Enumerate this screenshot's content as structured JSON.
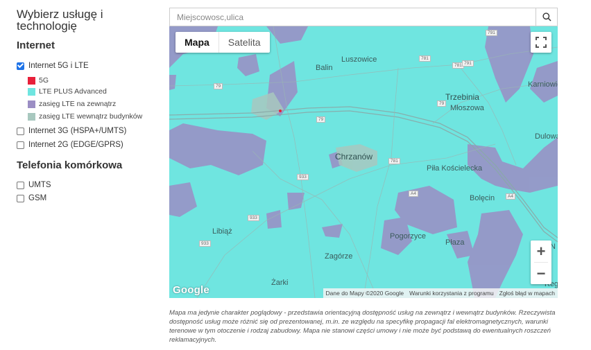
{
  "sidebar": {
    "title": "Wybierz usługę i technologię",
    "internet_heading": "Internet",
    "internet_options": [
      {
        "label": "Internet 5G i LTE",
        "checked": true
      },
      {
        "label": "Internet 3G (HSPA+/UMTS)",
        "checked": false
      },
      {
        "label": "Internet 2G (EDGE/GPRS)",
        "checked": false
      }
    ],
    "legend": [
      {
        "label": "5G",
        "color": "#e8203a"
      },
      {
        "label": "LTE PLUS Advanced",
        "color": "#6fe5e0"
      },
      {
        "label": "zasięg LTE na zewnątrz",
        "color": "#9b8ec4"
      },
      {
        "label": "zasięg LTE wewnątrz budynków",
        "color": "#a8c8bf"
      }
    ],
    "telephony_heading": "Telefonia komórkowa",
    "telephony_options": [
      {
        "label": "UMTS",
        "checked": false
      },
      {
        "label": "GSM",
        "checked": false
      }
    ]
  },
  "search": {
    "placeholder": "Miejscowosc,ulica",
    "icon": "search-icon"
  },
  "map": {
    "type_buttons": [
      "Mapa",
      "Satelita"
    ],
    "active_type": "Mapa",
    "fullscreen_icon": "fullscreen-icon",
    "zoom_in": "+",
    "zoom_out": "−",
    "logo": "Google",
    "attribution": [
      "Dane do Mapy ©2020 Google",
      "Warunki korzystania z programu",
      "Zgłoś błąd w mapach"
    ],
    "places": {
      "luszowice": "Luszowice",
      "balin": "Balin",
      "trzebinia": "Trzebinia",
      "mloszowa": "Młoszowa",
      "karniowice": "Karniowice",
      "dulowa": "Dulowa",
      "chrzanow": "Chrzanów",
      "pila": "Piła Kościelecka",
      "bolecin": "Bolęcin",
      "libiaz": "Libiąż",
      "pogorzyce": "Pogorzyce",
      "plaza": "Płaza",
      "zagorze": "Zagórze",
      "zarki": "Żarki",
      "n": "N",
      "reg": "Reg"
    },
    "roads": [
      "79",
      "79",
      "781",
      "933",
      "933",
      "933",
      "781",
      "79",
      "A4",
      "A4",
      "781",
      "791",
      "791"
    ]
  },
  "note": "Mapa ma jedynie charakter poglądowy - przedstawia orientacyjną dostępność usług na zewnątrz i wewnątrz budynków. Rzeczywista dostępność usług może różnić się od prezentowanej, m.in. ze względu na specyfikę propagacji fal elektromagnetycznych, warunki terenowe w tym otoczenie i rodzaj zabudowy. Mapa nie stanowi części umowy i nie może być podstawą do ewentualnych roszczeń reklamacyjnych."
}
